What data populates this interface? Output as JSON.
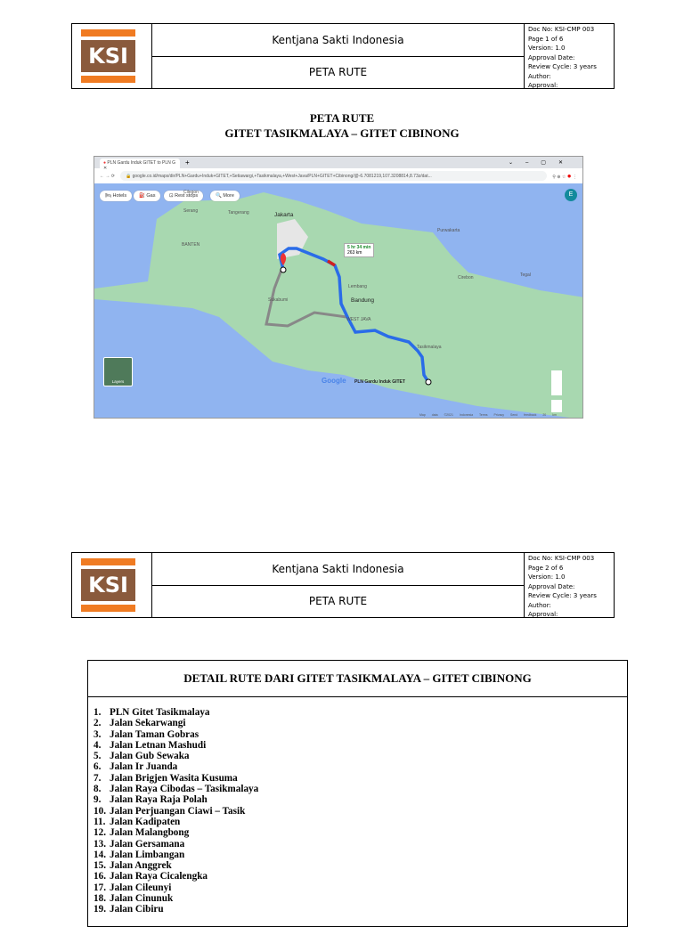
{
  "header": {
    "logo_text": "KSI",
    "company": "Kentjana Sakti Indonesia",
    "doc_title": "PETA RUTE"
  },
  "pages": [
    {
      "meta": [
        "Doc No: KSI-CMP 003",
        "Page 1 of 6",
        "Version: 1.0",
        "Approval Date:",
        "Review Cycle: 3 years",
        "Author:",
        "Approval:"
      ]
    },
    {
      "meta": [
        "Doc No: KSI-CMP 003",
        "Page 2 of 6",
        "Version: 1.0",
        "Approval Date:",
        "Review Cycle: 3 years",
        "Author:",
        "Approval:"
      ]
    }
  ],
  "page1": {
    "title": "PETA RUTE",
    "subtitle": "GITET TASIKMALAYA – GITET CIBINONG"
  },
  "browser": {
    "tab_title": "PLN Gardu Induk GITET to PLN G",
    "url": "google.co.id/maps/dir/PLN+Gardu+Induk+GITET,+Setiawargi,+Tasikmalaya,+West+Java/PLN+GITET+Cibinong/@-6.7081219,107.3208814,8.73z/dat...",
    "avatar": "E"
  },
  "map": {
    "chips": [
      "Hotels",
      "Gas",
      "Rest stops",
      "More"
    ],
    "duration": "5 hr 34 min",
    "distance": "263 km",
    "destination_label": "PLN Gardu Induk GITET",
    "places": [
      "Cilegon",
      "Serang",
      "Tangerang",
      "Jakarta",
      "BANTEN",
      "Bandung",
      "Lembang",
      "WEST JAVA",
      "Tasikmalaya",
      "Cirebon",
      "Sukabumi",
      "Purwakarta",
      "Tegal"
    ],
    "layers": "Layers",
    "footer": [
      "Map data ©2021",
      "Indonesia",
      "Terms",
      "Privacy",
      "Send feedback",
      "20 km"
    ],
    "brand": "Google"
  },
  "detail": {
    "title": "DETAIL RUTE DARI GITET TASIKMALAYA – GITET CIBINONG",
    "items": [
      "PLN Gitet Tasikmalaya",
      "Jalan Sekarwangi",
      "Jalan Taman Gobras",
      "Jalan Letnan Mashudi",
      "Jalan Gub Sewaka",
      "Jalan Ir Juanda",
      "Jalan Brigjen Wasita Kusuma",
      "Jalan Raya Cibodas – Tasikmalaya",
      "Jalan Raya Raja Polah",
      "Jalan Perjuangan Ciawi – Tasik",
      "Jalan Kadipaten",
      "Jalan Malangbong",
      "Jalan Gersamana",
      "Jalan Limbangan",
      "Jalan Anggrek",
      "Jalan Raya Cicalengka",
      "Jalan Cileunyi",
      "Jalan Cinunuk",
      "Jalan Cibiru"
    ]
  }
}
